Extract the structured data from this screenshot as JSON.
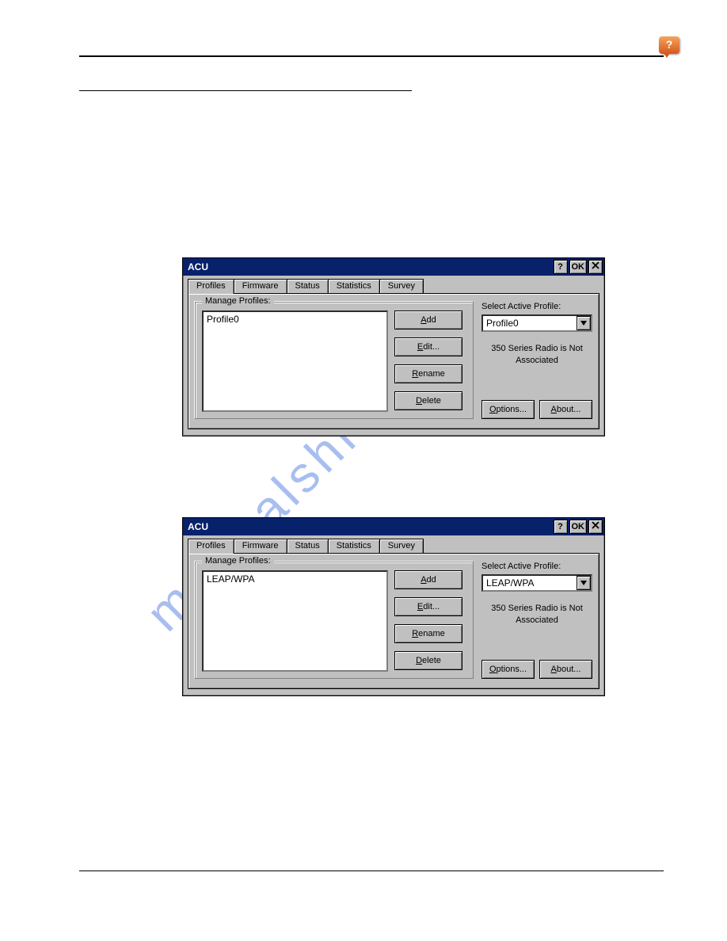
{
  "toolbar": {
    "help_glyph": "?"
  },
  "watermark": "manualshive.com",
  "dialog1": {
    "title": "ACU",
    "title_help": "?",
    "title_ok": "OK",
    "tabs": [
      "Profiles",
      "Firmware",
      "Status",
      "Statistics",
      "Survey"
    ],
    "manage_legend": "Manage Profiles:",
    "list_item": "Profile0",
    "buttons": {
      "add": "Add",
      "edit": "Edit...",
      "rename": "Rename",
      "delete": "Delete"
    },
    "acc": {
      "add": "A",
      "edit": "E",
      "rename": "R",
      "delete": "D",
      "options": "O",
      "about": "A"
    },
    "select_label": "Select Active Profile:",
    "active_value": "Profile0",
    "status_line1": "350 Series Radio is Not",
    "status_line2": "Associated",
    "options": "Options...",
    "about": "About..."
  },
  "dialog2": {
    "title": "ACU",
    "title_help": "?",
    "title_ok": "OK",
    "tabs": [
      "Profiles",
      "Firmware",
      "Status",
      "Statistics",
      "Survey"
    ],
    "manage_legend": "Manage Profiles:",
    "list_item": "LEAP/WPA",
    "buttons": {
      "add": "Add",
      "edit": "Edit...",
      "rename": "Rename",
      "delete": "Delete"
    },
    "acc": {
      "add": "A",
      "edit": "E",
      "rename": "R",
      "delete": "D",
      "options": "O",
      "about": "A"
    },
    "select_label": "Select Active Profile:",
    "active_value": "LEAP/WPA",
    "status_line1": "350 Series Radio is Not",
    "status_line2": "Associated",
    "options": "Options...",
    "about": "About..."
  }
}
